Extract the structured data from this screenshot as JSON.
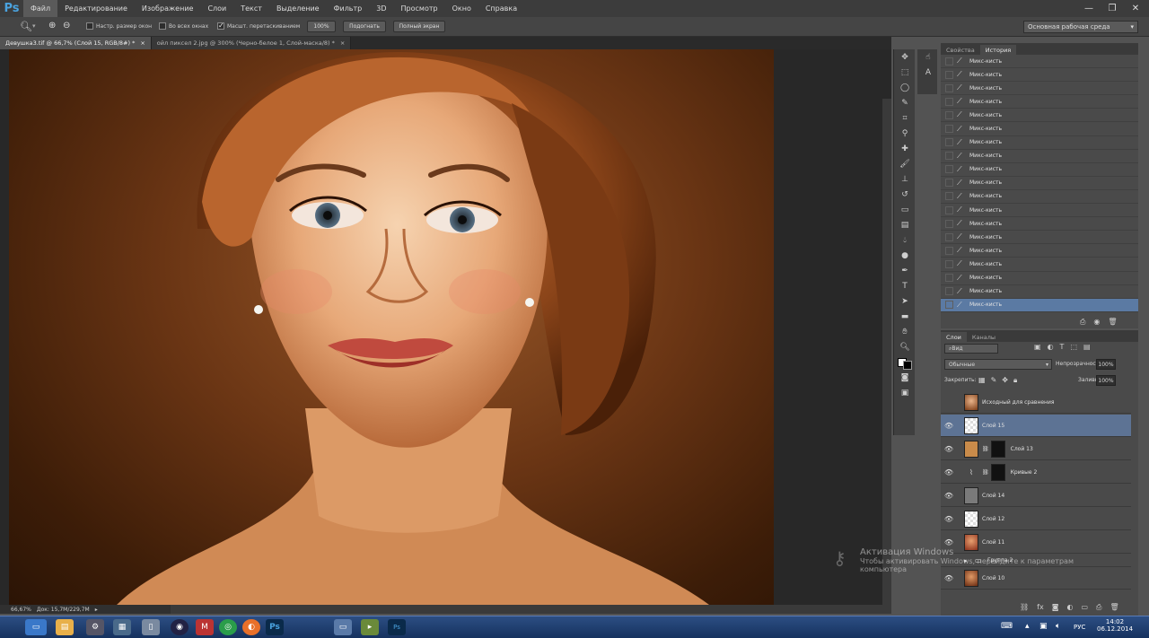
{
  "app": {
    "logo": "Ps"
  },
  "menubar": {
    "items": [
      "Файл",
      "Редактирование",
      "Изображение",
      "Слои",
      "Текст",
      "Выделение",
      "Фильтр",
      "3D",
      "Просмотр",
      "Окно",
      "Справка"
    ]
  },
  "options": {
    "chk1": "Настр. размер окон",
    "chk2": "Во всех окнах",
    "chk3": "Масшт. перетаскиванием",
    "zoom_value": "100%",
    "fit_button": "Подогнать",
    "fullscreen_button": "Полный экран",
    "workspace": "Основная рабочая среда"
  },
  "tabs": [
    {
      "label": "Девушка3.tif @ 66,7% (Слой 15, RGB/8#) *"
    },
    {
      "label": "ойл пиксел 2.jpg @ 300% (Черно-белое 1, Слой-маска/8) *"
    }
  ],
  "status": {
    "zoom": "66,67%",
    "doc": "Док: 15,7M/229,7M"
  },
  "history": {
    "tabs": [
      "Свойства",
      "История"
    ],
    "items": [
      "Микс-кисть",
      "Микс-кисть",
      "Микс-кисть",
      "Микс-кисть",
      "Микс-кисть",
      "Микс-кисть",
      "Микс-кисть",
      "Микс-кисть",
      "Микс-кисть",
      "Микс-кисть",
      "Микс-кисть",
      "Микс-кисть",
      "Микс-кисть",
      "Микс-кисть",
      "Микс-кисть",
      "Микс-кисть",
      "Микс-кисть",
      "Микс-кисть",
      "Микс-кисть"
    ]
  },
  "layers": {
    "tabs": [
      "Слои",
      "Каналы"
    ],
    "filter": "Вид",
    "blend_mode": "Обычные",
    "opacity_label": "Непрозрачность:",
    "opacity_value": "100%",
    "lock_label": "Закрепить:",
    "fill_label": "Заливка:",
    "fill_value": "100%",
    "rows": [
      {
        "name": "Исходный для сравнения"
      },
      {
        "name": "Слой 15"
      },
      {
        "name": "Слой 13"
      },
      {
        "name": "Кривые 2"
      },
      {
        "name": "Слой 14"
      },
      {
        "name": "Слой 12"
      },
      {
        "name": "Слой 11"
      },
      {
        "name": "Группа 2"
      },
      {
        "name": "Слой 10"
      }
    ]
  },
  "watermark": {
    "title": "Активация Windows",
    "line1": "Чтобы активировать Windows, перейдите к параметрам",
    "line2": "компьютера"
  },
  "taskbar": {
    "lang": "РУС",
    "time": "14:02",
    "date": "06.12.2014"
  }
}
